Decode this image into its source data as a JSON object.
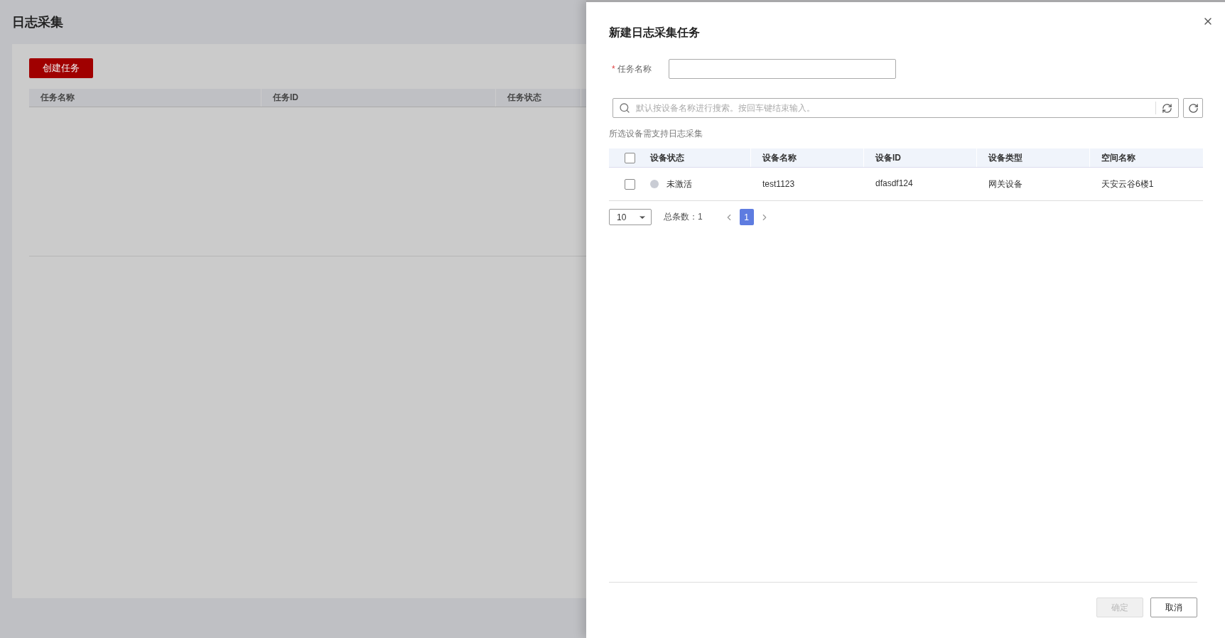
{
  "page": {
    "title": "日志采集",
    "create_button": "创建任务",
    "columns": [
      "任务名称",
      "任务ID",
      "任务状态"
    ]
  },
  "drawer": {
    "title": "新建日志采集任务",
    "task_name": {
      "label": "任务名称",
      "required_mark": "*"
    },
    "search": {
      "placeholder": "默认按设备名称进行搜索。按回车键结束输入。"
    },
    "note": "所选设备需支持日志采集",
    "table": {
      "select_all": {
        "checked": false
      },
      "columns": [
        "设备状态",
        "设备名称",
        "设备ID",
        "设备类型",
        "空间名称"
      ],
      "rows": [
        {
          "checked": false,
          "status": "未激活",
          "color": "#c9ccd4",
          "name": "test1123",
          "id": "dfasdf124",
          "type": "网关设备",
          "space": "天安云谷6楼1"
        }
      ]
    },
    "pagination": {
      "page_size": "10",
      "total": "总条数：1",
      "pages": [
        {
          "label": "1",
          "selected": true
        }
      ]
    },
    "buttons": [
      {
        "label": "确定",
        "disabled": true
      },
      {
        "label": "取消",
        "disabled": false
      }
    ]
  }
}
